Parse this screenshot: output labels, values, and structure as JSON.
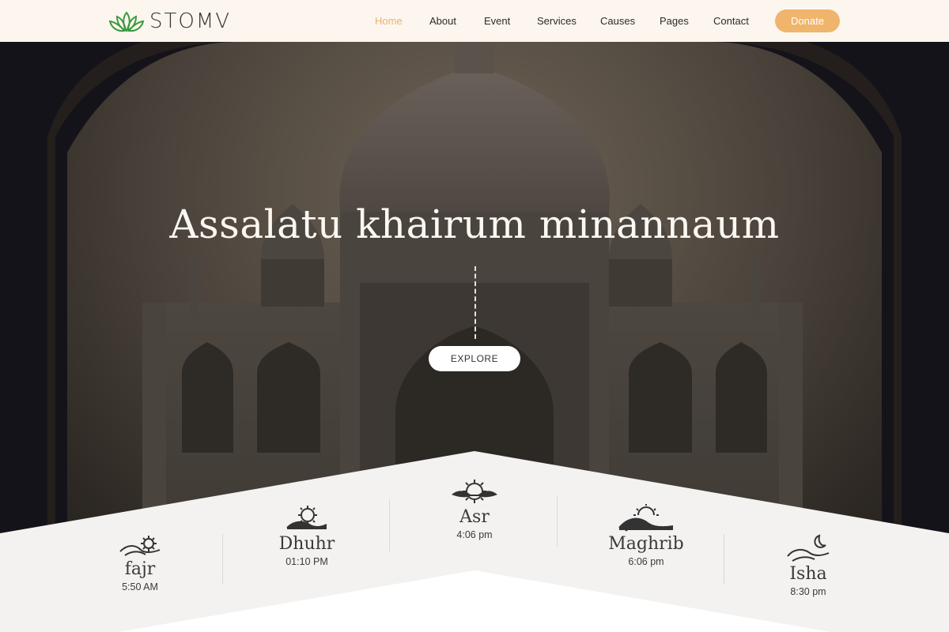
{
  "brand": {
    "name": "STOMV",
    "logo_icon": "lotus-icon",
    "accent": "#efb56c",
    "logo_color": "#3a9a3f"
  },
  "nav": {
    "items": [
      {
        "label": "Home",
        "active": true
      },
      {
        "label": "About",
        "active": false
      },
      {
        "label": "Event",
        "active": false
      },
      {
        "label": "Services",
        "active": false
      },
      {
        "label": "Causes",
        "active": false
      },
      {
        "label": "Pages",
        "active": false
      },
      {
        "label": "Contact",
        "active": false
      }
    ],
    "donate_label": "Donate"
  },
  "hero": {
    "title": "Assalatu khairum minannaum",
    "button_label": "EXPLORE"
  },
  "prayers": [
    {
      "name": "fajr",
      "time": "5:50 AM",
      "icon": "sunrise-waves-icon"
    },
    {
      "name": "Dhuhr",
      "time": "01:10 PM",
      "icon": "sun-waves-icon"
    },
    {
      "name": "Asr",
      "time": "4:06 pm",
      "icon": "sun-wave-icon"
    },
    {
      "name": "Maghrib",
      "time": "6:06 pm",
      "icon": "sunset-waves-icon"
    },
    {
      "name": "Isha",
      "time": "8:30 pm",
      "icon": "moon-waves-icon"
    }
  ]
}
